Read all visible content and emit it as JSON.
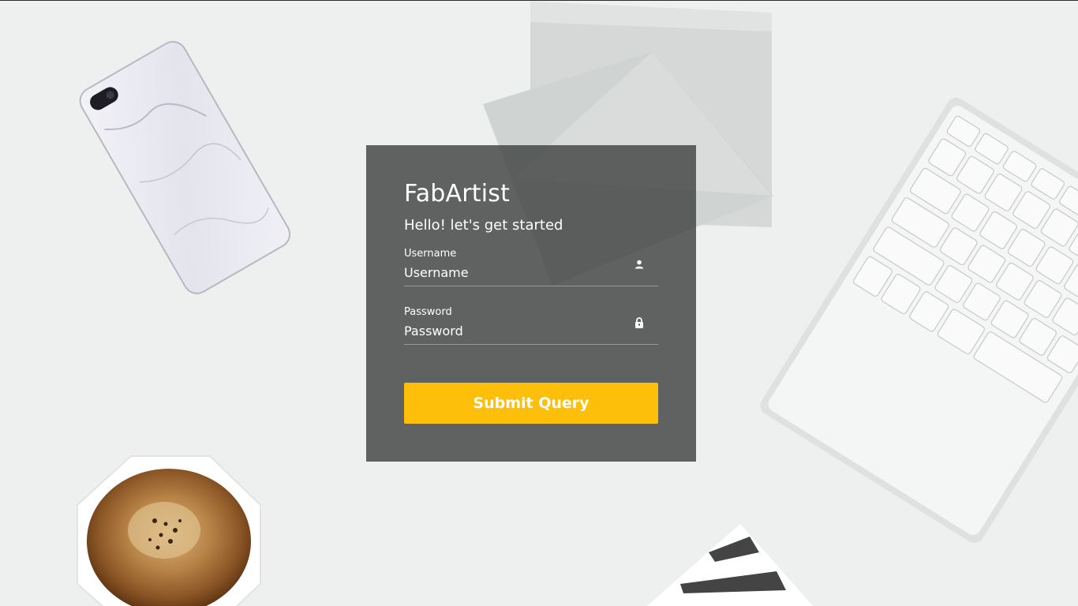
{
  "login": {
    "brand": "FabArtist",
    "subtitle": "Hello! let's get started",
    "username": {
      "label": "Username",
      "placeholder": "Username",
      "icon": "user-icon"
    },
    "password": {
      "label": "Password",
      "placeholder": "Password",
      "icon": "lock-icon"
    },
    "submit_label": "Submit Query"
  },
  "colors": {
    "accent": "#fdbf0a",
    "card_background": "#484949",
    "text": "#ffffff",
    "page_background": "#eef0f0"
  }
}
